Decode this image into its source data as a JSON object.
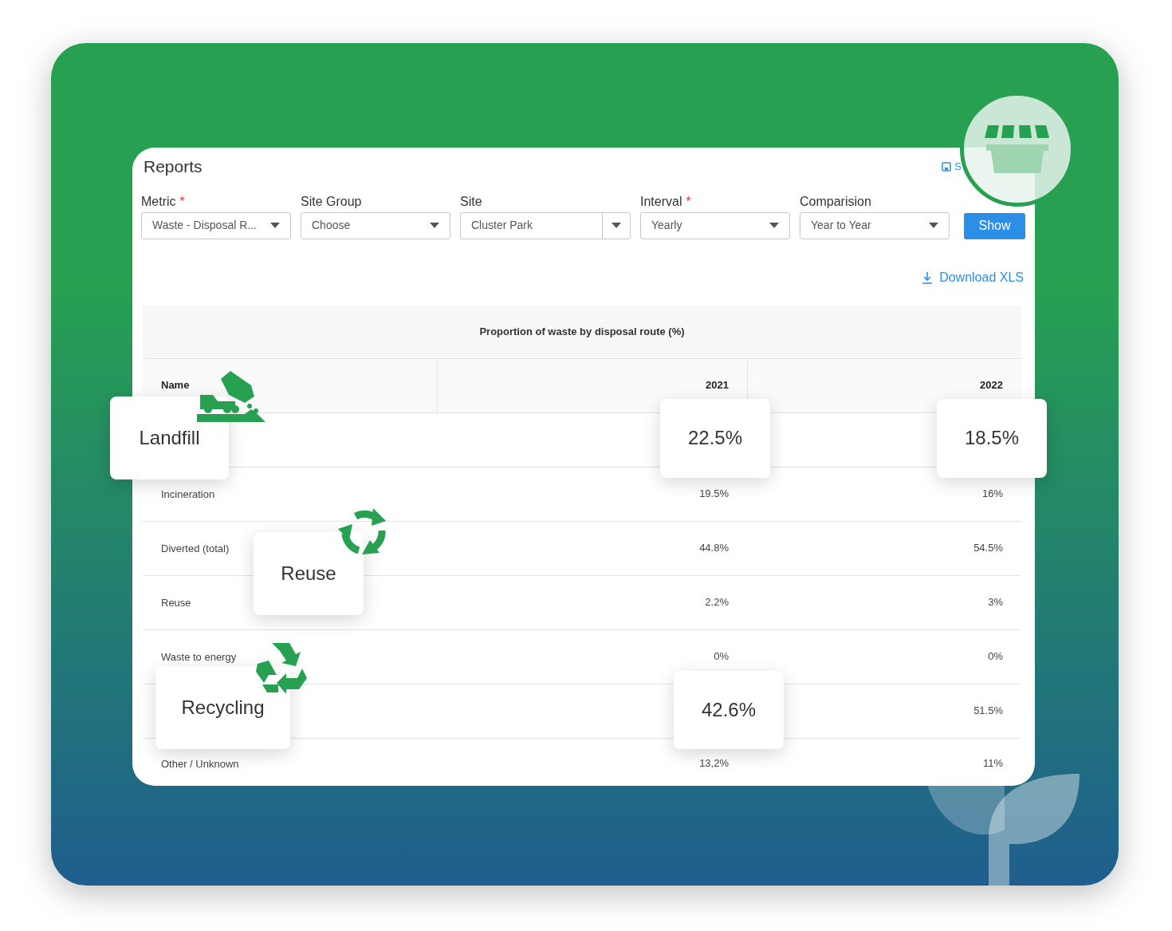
{
  "panel": {
    "title": "Reports",
    "saved_filters": "S"
  },
  "required_marker": "*",
  "filters": [
    {
      "kind": "select",
      "label": "Metric",
      "required": true,
      "value": "Waste - Disposal R..."
    },
    {
      "kind": "select",
      "label": "Site Group",
      "required": false,
      "value": "Choose"
    },
    {
      "kind": "combo",
      "label": "Site",
      "required": false,
      "value": "Cluster Park"
    },
    {
      "kind": "select",
      "label": "Interval",
      "required": true,
      "value": "Yearly"
    },
    {
      "kind": "select",
      "label": "Comparision",
      "required": false,
      "value": "Year to Year"
    }
  ],
  "show_button": "Show",
  "download_link": "Download XLS",
  "table": {
    "title": "Proportion of waste by disposal route (%)",
    "columns": [
      "Name",
      "2021",
      "2022"
    ],
    "rows": [
      {
        "cells": [
          {
            "text": "Landfill",
            "callout": true
          },
          {
            "text": "22.5%",
            "callout": true
          },
          {
            "text": "18.5%",
            "callout": true
          }
        ]
      },
      {
        "cells": [
          {
            "text": "Incineration",
            "callout": false
          },
          {
            "text": "19.5%",
            "callout": false
          },
          {
            "text": "16%",
            "callout": false
          }
        ]
      },
      {
        "cells": [
          {
            "text": "Diverted (total)",
            "callout": false
          },
          {
            "text": "44.8%",
            "callout": false
          },
          {
            "text": "54.5%",
            "callout": false
          }
        ]
      },
      {
        "cells": [
          {
            "text": "Reuse",
            "callout": false
          },
          {
            "text": "2.2%",
            "callout": false
          },
          {
            "text": "3%",
            "callout": false
          }
        ]
      },
      {
        "cells": [
          {
            "text": "Waste to energy",
            "callout": false
          },
          {
            "text": "0%",
            "callout": false
          },
          {
            "text": "0%",
            "callout": false
          }
        ]
      },
      {
        "cells": [
          {
            "text": "Recycling",
            "callout": true
          },
          {
            "text": "42.6%",
            "callout": true
          },
          {
            "text": "51.5%",
            "callout": false
          }
        ]
      },
      {
        "cells": [
          {
            "text": "Other / Unknown",
            "callout": false
          },
          {
            "text": "13,2%",
            "callout": false
          },
          {
            "text": "11%",
            "callout": false
          }
        ]
      }
    ]
  },
  "floating_labels": [
    "Reuse"
  ]
}
